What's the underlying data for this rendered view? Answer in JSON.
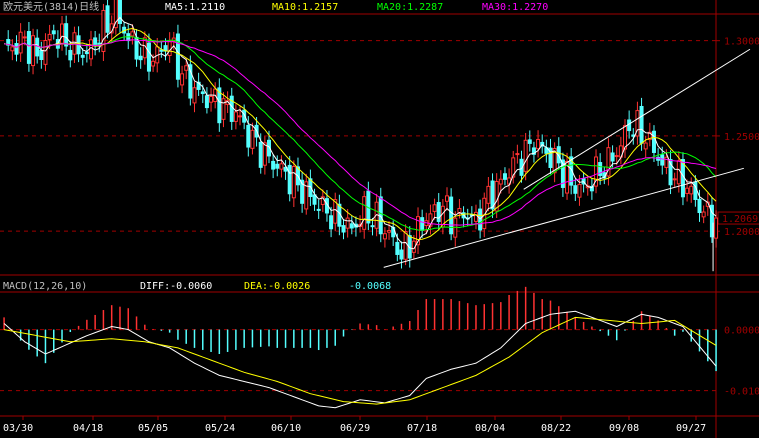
{
  "header": {
    "title": "欧元美元(3814)日线",
    "ma5": "MA5:1.2110",
    "ma10": "MA10:1.2157",
    "ma20": "MA20:1.2287",
    "ma30": "MA30:1.2270"
  },
  "macd_header": {
    "title": "MACD(12,26,10)",
    "diff": "DIFF:-0.0060",
    "dea": "DEA:-0.0026",
    "macd": "-0.0068"
  },
  "price_axis": {
    "ticks": [
      "1.3000",
      "1.2500",
      "1.2000"
    ],
    "last": "1.2069"
  },
  "macd_axis": {
    "ticks": [
      "0.0000",
      "-0.0100"
    ]
  },
  "date_labels": [
    "03/30",
    "04/18",
    "05/05",
    "05/24",
    "06/10",
    "06/29",
    "07/18",
    "08/04",
    "08/22",
    "09/08",
    "09/27"
  ],
  "colors": {
    "up": "#ff3232",
    "down": "#54ffff",
    "ma5": "#ffffff",
    "ma10": "#ffff00",
    "ma20": "#00ff00",
    "ma30": "#ff00ff",
    "grid": "#a00000",
    "channel": "#ffffff"
  },
  "chart_data": {
    "type": "candlestick",
    "instrument": "欧元美元(3814)日线",
    "ylim": [
      1.177,
      1.314
    ],
    "price_grid": [
      1.3,
      1.25,
      1.2
    ],
    "last_price": 1.2069,
    "trend_channel": {
      "upper": [
        [
          0.69,
          1.222
        ],
        [
          0.75,
          1.258
        ],
        [
          0.83,
          1.2755
        ]
      ],
      "lower": [
        [
          0.69,
          1.181
        ],
        [
          0.75,
          1.2085
        ],
        [
          0.98,
          1.2285
        ]
      ]
    },
    "moving_averages": [
      {
        "name": "MA5",
        "last": 1.211
      },
      {
        "name": "MA10",
        "last": 1.2157
      },
      {
        "name": "MA20",
        "last": 1.2287
      },
      {
        "name": "MA30",
        "last": 1.227
      }
    ],
    "close_path": [
      [
        0,
        1.295
      ],
      [
        5,
        1.3
      ],
      [
        8,
        1.292
      ],
      [
        12,
        1.304
      ],
      [
        16,
        1.297
      ],
      [
        20,
        1.293
      ],
      [
        24,
        1.306
      ],
      [
        27,
        1.316
      ],
      [
        30,
        1.301
      ],
      [
        33,
        1.293
      ],
      [
        36,
        1.29
      ],
      [
        40,
        1.3
      ],
      [
        43,
        1.282
      ],
      [
        47,
        1.272
      ],
      [
        51,
        1.268
      ],
      [
        56,
        1.262
      ],
      [
        60,
        1.248
      ],
      [
        64,
        1.238
      ],
      [
        68,
        1.23
      ],
      [
        72,
        1.222
      ],
      [
        76,
        1.214
      ],
      [
        80,
        1.207
      ],
      [
        84,
        1.201
      ],
      [
        87,
        1.21
      ],
      [
        90,
        1.206
      ],
      [
        93,
        1.198
      ],
      [
        96,
        1.188
      ],
      [
        99,
        1.196
      ],
      [
        101,
        1.205
      ],
      [
        103,
        1.208
      ],
      [
        106,
        1.213
      ],
      [
        109,
        1.205
      ],
      [
        111,
        1.21
      ],
      [
        114,
        1.205
      ],
      [
        117,
        1.218
      ],
      [
        120,
        1.225
      ],
      [
        123,
        1.235
      ],
      [
        126,
        1.241
      ],
      [
        128,
        1.247
      ],
      [
        130,
        1.243
      ],
      [
        134,
        1.235
      ],
      [
        137,
        1.225
      ],
      [
        140,
        1.222
      ],
      [
        143,
        1.23
      ],
      [
        146,
        1.236
      ],
      [
        149,
        1.245
      ],
      [
        151,
        1.256
      ],
      [
        154,
        1.252
      ],
      [
        157,
        1.243
      ],
      [
        160,
        1.232
      ],
      [
        163,
        1.228
      ],
      [
        166,
        1.22
      ],
      [
        169,
        1.21
      ],
      [
        172,
        1.204
      ]
    ],
    "macd": {
      "zero_line": 0,
      "ylim": [
        -0.0135,
        0.0055
      ],
      "diff_last": -0.006,
      "dea_last": -0.0026,
      "macd_last": -0.0068,
      "diff": [
        [
          0,
          0.001
        ],
        [
          5,
          -0.002
        ],
        [
          10,
          -0.004
        ],
        [
          15,
          -0.0025
        ],
        [
          20,
          -0.001
        ],
        [
          26,
          0.0005
        ],
        [
          30,
          0.0
        ],
        [
          35,
          -0.002
        ],
        [
          40,
          -0.003
        ],
        [
          46,
          -0.0055
        ],
        [
          52,
          -0.0075
        ],
        [
          58,
          -0.0085
        ],
        [
          64,
          -0.0095
        ],
        [
          70,
          -0.011
        ],
        [
          76,
          -0.0125
        ],
        [
          80,
          -0.0128
        ],
        [
          86,
          -0.0115
        ],
        [
          92,
          -0.012
        ],
        [
          98,
          -0.0108
        ],
        [
          102,
          -0.008
        ],
        [
          108,
          -0.0065
        ],
        [
          114,
          -0.0055
        ],
        [
          120,
          -0.003
        ],
        [
          126,
          0.001
        ],
        [
          132,
          0.0025
        ],
        [
          138,
          0.003
        ],
        [
          144,
          0.0015
        ],
        [
          148,
          0.0005
        ],
        [
          154,
          0.0025
        ],
        [
          158,
          0.002
        ],
        [
          164,
          0.0005
        ],
        [
          172,
          -0.006
        ]
      ],
      "dea": [
        [
          0,
          0.0
        ],
        [
          8,
          -0.001
        ],
        [
          16,
          -0.002
        ],
        [
          26,
          -0.0015
        ],
        [
          34,
          -0.002
        ],
        [
          42,
          -0.003
        ],
        [
          50,
          -0.005
        ],
        [
          58,
          -0.007
        ],
        [
          66,
          -0.0085
        ],
        [
          74,
          -0.0105
        ],
        [
          82,
          -0.0118
        ],
        [
          90,
          -0.0122
        ],
        [
          98,
          -0.0115
        ],
        [
          106,
          -0.0095
        ],
        [
          114,
          -0.0075
        ],
        [
          122,
          -0.0045
        ],
        [
          130,
          -0.0005
        ],
        [
          138,
          0.002
        ],
        [
          146,
          0.0015
        ],
        [
          154,
          0.001
        ],
        [
          162,
          0.0015
        ],
        [
          172,
          -0.0026
        ]
      ],
      "histogram_signs": [
        [
          0,
          6,
          "up"
        ],
        [
          7,
          14,
          "down"
        ],
        [
          22,
          28,
          "up"
        ],
        [
          36,
          66,
          "down"
        ],
        [
          80,
          85,
          "up"
        ],
        [
          86,
          96,
          "down"
        ],
        [
          98,
          102,
          "up"
        ],
        [
          104,
          113,
          "up"
        ],
        [
          114,
          118,
          "down"
        ],
        [
          120,
          133,
          "up"
        ],
        [
          134,
          143,
          "up"
        ],
        [
          144,
          150,
          "up"
        ],
        [
          151,
          156,
          "up"
        ],
        [
          157,
          172,
          "down"
        ]
      ]
    }
  }
}
